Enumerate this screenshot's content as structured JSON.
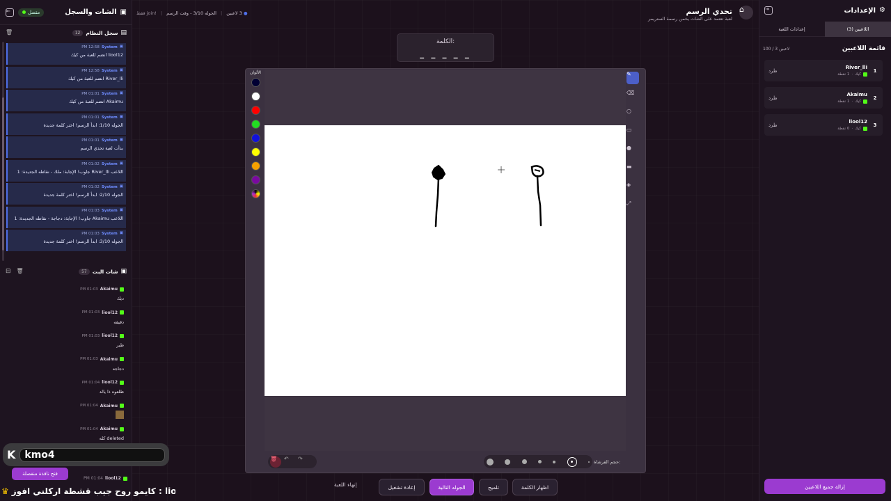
{
  "left_panel": {
    "title": "الشات والسجل",
    "online_label": "متصل",
    "system_log": {
      "title": "سجل النظام",
      "count": "12",
      "items": [
        {
          "sender": "System",
          "time": "PM 12:58",
          "message": "liool12 انضم للعبة من كيك"
        },
        {
          "sender": "System",
          "time": "PM 12:58",
          "message": "River_lli انضم للعبة من كيك"
        },
        {
          "sender": "System",
          "time": "PM 01:01",
          "message": "Akaimu انضم للعبة من كيك"
        },
        {
          "sender": "System",
          "time": "PM 01:01",
          "message": "الجوله 1/10: ابدأ الرسم! اختر كلمة جديدة"
        },
        {
          "sender": "System",
          "time": "PM 01:01",
          "message": "بدأت لعبة تحدي الرسم"
        },
        {
          "sender": "System",
          "time": "PM 01:02",
          "message": "اللاعب River_lli جاوب! الإجابة: ملك - نقاطه الجديدة: 1"
        },
        {
          "sender": "System",
          "time": "PM 01:02",
          "message": "الجوله 2/10: ابدأ الرسم! اختر كلمة جديدة"
        },
        {
          "sender": "System",
          "time": "PM 01:03",
          "message": "اللاعب Akaimu جاوب! الإجابة: دجاجة - نقاطه الجديدة: 1"
        },
        {
          "sender": "System",
          "time": "PM 01:03",
          "message": "الجوله 3/10: ابدأ الرسم! اختر كلمة جديدة"
        }
      ]
    },
    "bot_chat": {
      "title": "شات البث",
      "count": "57",
      "items": [
        {
          "user": "Akaimu",
          "time": "PM 01:03",
          "message": "ديك"
        },
        {
          "user": "liool12",
          "time": "PM 01:03",
          "message": "دقيقه"
        },
        {
          "user": "liool12",
          "time": "PM 01:03",
          "message": "طير"
        },
        {
          "user": "Akaimu",
          "time": "PM 01:03",
          "message": "دجاجه"
        },
        {
          "user": "liool12",
          "time": "PM 01:04",
          "message": "ظلعوه ذا يالد"
        },
        {
          "user": "Akaimu",
          "time": "PM 01:04",
          "message": ""
        },
        {
          "user": "Akaimu",
          "time": "PM 01:04",
          "message": "deleted كله"
        }
      ],
      "last_item": {
        "user": "liool12",
        "time": "PM 01:04"
      }
    },
    "overlay_name": "kmo4",
    "popout_button": "فتح نافذة منفصلة",
    "ticker": "كايمو روح جيب قشطة اركلني افوز : liool12"
  },
  "header": {
    "title": "تحدي الرسم",
    "subtitle": "لعبة تعتمد على الشات يخمن رسمة الستريمر",
    "players": "3 لاعبين",
    "round": "الجوله 3/10 - وقت الرسم",
    "join": "!join فقط"
  },
  "word": {
    "label": "الكلمة:",
    "mask": "_ _ _ _ _"
  },
  "palette": {
    "label": "الألوان",
    "colors": [
      "#000033",
      "#ffffff",
      "#ff0000",
      "#22dd22",
      "#1111dd",
      "#ffff00",
      "#f5a000",
      "#7a0aa0"
    ]
  },
  "tools": [
    "pencil-icon",
    "eraser-icon",
    "circle-icon",
    "rectangle-icon",
    "dot-icon",
    "line-icon",
    "fill-icon",
    "expand-icon"
  ],
  "brush": {
    "label": "حجم الفرشاة:"
  },
  "bottom_buttons": {
    "show_word": "اظهار الكلمة",
    "hint": "تلميح",
    "next_round": "الجوله التالية",
    "restart": "إعادة تشغيل",
    "end_game": "إنهاء اللعبة"
  },
  "right_panel": {
    "title": "الإعدادات",
    "tabs": [
      "اللاعبين (3)",
      "إعدادات اللعبة"
    ],
    "player_list_title": "قائمة اللاعبين",
    "player_count": "100 / 3 لاعبين",
    "kick_label": "طرد",
    "players": [
      {
        "rank": "1",
        "name": "River_lli",
        "stats": "1 نقطة"
      },
      {
        "rank": "2",
        "name": "Akaimu",
        "stats": "1 نقطة"
      },
      {
        "rank": "3",
        "name": "liool12",
        "stats": "0 نقطة"
      }
    ],
    "platform": "كيك",
    "remove_all": "إزالة جميع اللاعبين"
  }
}
